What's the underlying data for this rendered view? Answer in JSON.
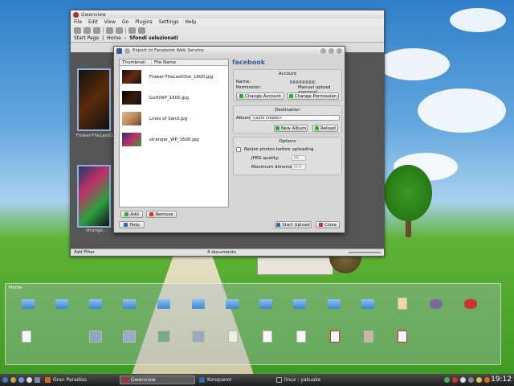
{
  "gwenview": {
    "title": "Gwenview",
    "menu": [
      "File",
      "Edit",
      "View",
      "Go",
      "Plugins",
      "Settings",
      "Help"
    ],
    "crumbs": {
      "start": "Start Page",
      "home": "Home",
      "folder": "Sfondi selezionati"
    },
    "thumbs": [
      {
        "label": "Flower-TheLastO..."
      },
      {
        "label": "strange..."
      }
    ],
    "status": {
      "addfilter": "Add Filter",
      "docs": "4 documents"
    }
  },
  "dialog": {
    "title": "Export to Facebook Web Service",
    "columns": {
      "thumb": "Thumbnail",
      "name": "File Name"
    },
    "files": [
      {
        "name": "Flower-TheLastOne_1600.jpg",
        "color": "#6b2a10"
      },
      {
        "name": "GothWP_1600.jpg",
        "color": "#3a1a08"
      },
      {
        "name": "Lines of Sand.jpg",
        "color": "#c08a60"
      },
      {
        "name": "stranger_WP_1600.jpg",
        "color": "#2a5a30"
      }
    ],
    "add": "Add",
    "remove": "Remove",
    "help": "Help",
    "brand": "facebook",
    "account": {
      "title": "Account",
      "name_label": "Name:",
      "permission_label": "Permission:",
      "permission_value": "Manual upload approval",
      "change_account": "Change Account",
      "change_permission": "Change Permission"
    },
    "destination": {
      "title": "Destination",
      "album_label": "Album:",
      "album_value": "<auto create>",
      "new_album": "New Album",
      "reload": "Reload"
    },
    "options": {
      "title": "Options",
      "resize": "Resize photos before uploading",
      "jpeg_label": "JPEG quality:",
      "jpeg_value": "85",
      "maxdim_label": "Maximum dimension:",
      "maxdim_value": "604"
    },
    "start": "Start Upload",
    "close": "Close"
  },
  "home": {
    "label": "Home"
  },
  "taskbar": {
    "tasks": [
      {
        "label": "Gran Paradiso",
        "active": false
      },
      {
        "label": "Gwenview",
        "active": true
      },
      {
        "label": "Konqueror",
        "active": false
      },
      {
        "label": "linux : yakuake",
        "active": false
      }
    ],
    "clock": "19:12"
  }
}
